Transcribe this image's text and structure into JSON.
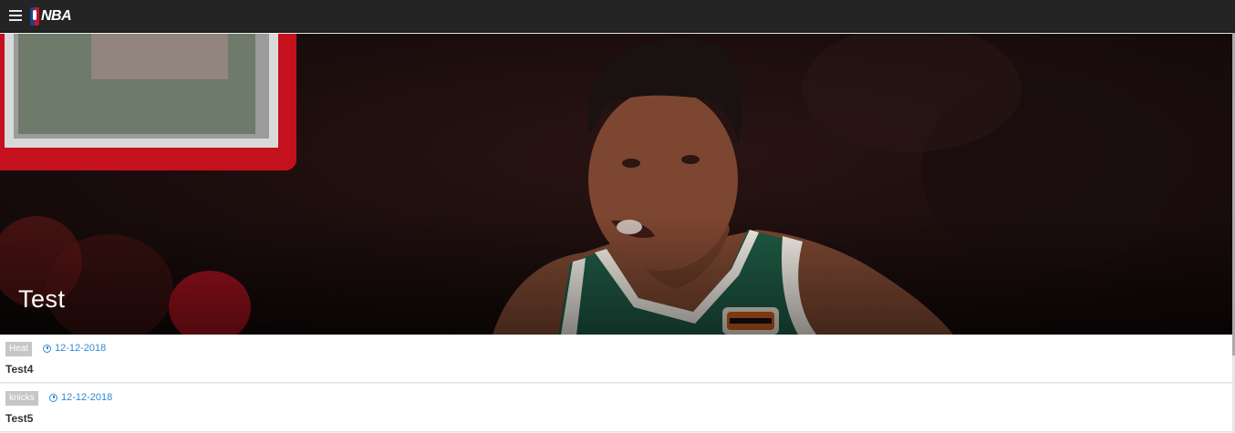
{
  "header": {
    "menu_icon": "hamburger-menu-icon",
    "logo_text": "NBA"
  },
  "hero": {
    "title": "Test"
  },
  "articles": [
    {
      "tag": "Heat",
      "date": "12-12-2018",
      "title": "Test4"
    },
    {
      "tag": "knicks",
      "date": "12-12-2018",
      "title": "Test5"
    }
  ],
  "colors": {
    "topbar": "#242424",
    "tag_bg": "#c6c6c6",
    "date_blue": "#2b8ad6",
    "jersey_green": "#1f5a45"
  }
}
